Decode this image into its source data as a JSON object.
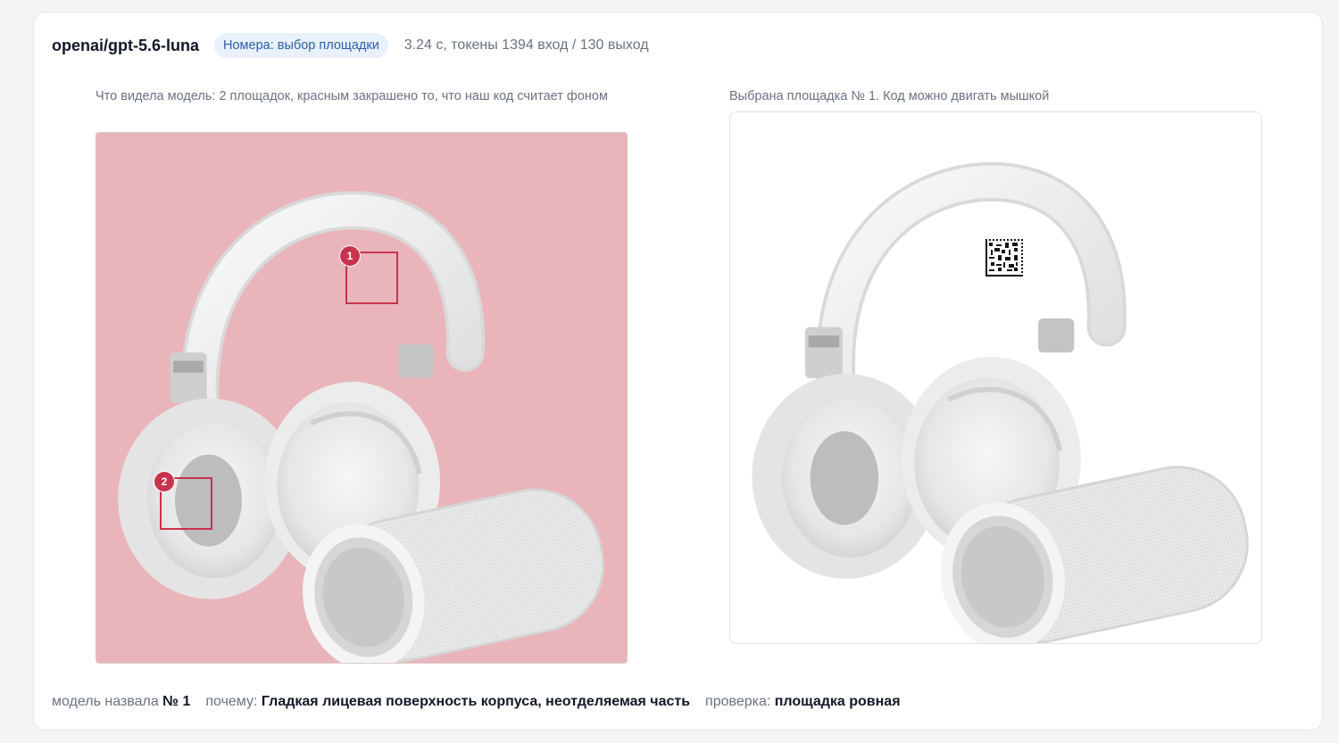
{
  "header": {
    "model": "openai/gpt-5.6-luna",
    "badge": "Номера: выбор площадки",
    "meta": "3.24 с, токены 1394 вход / 130 выход"
  },
  "left_panel": {
    "caption": "Что видела модель: 2 площадок, красным закрашено то, что наш код считает фоном",
    "zones": [
      {
        "label": "1"
      },
      {
        "label": "2"
      }
    ]
  },
  "right_panel": {
    "caption": "Выбрана площадка № 1. Код можно двигать мышкой"
  },
  "footer": {
    "named_label": "модель назвала",
    "named_value": "№ 1",
    "why_label": "почему:",
    "why_value": "Гладкая лицевая поверхность корпуса, неотделяемая часть",
    "check_label": "проверка:",
    "check_value": "площадка ровная"
  },
  "colors": {
    "background_mask": "#e9b5bb",
    "zone_border": "#c8334d",
    "badge_bg": "#e8f0fb",
    "badge_text": "#2f5fa8"
  }
}
